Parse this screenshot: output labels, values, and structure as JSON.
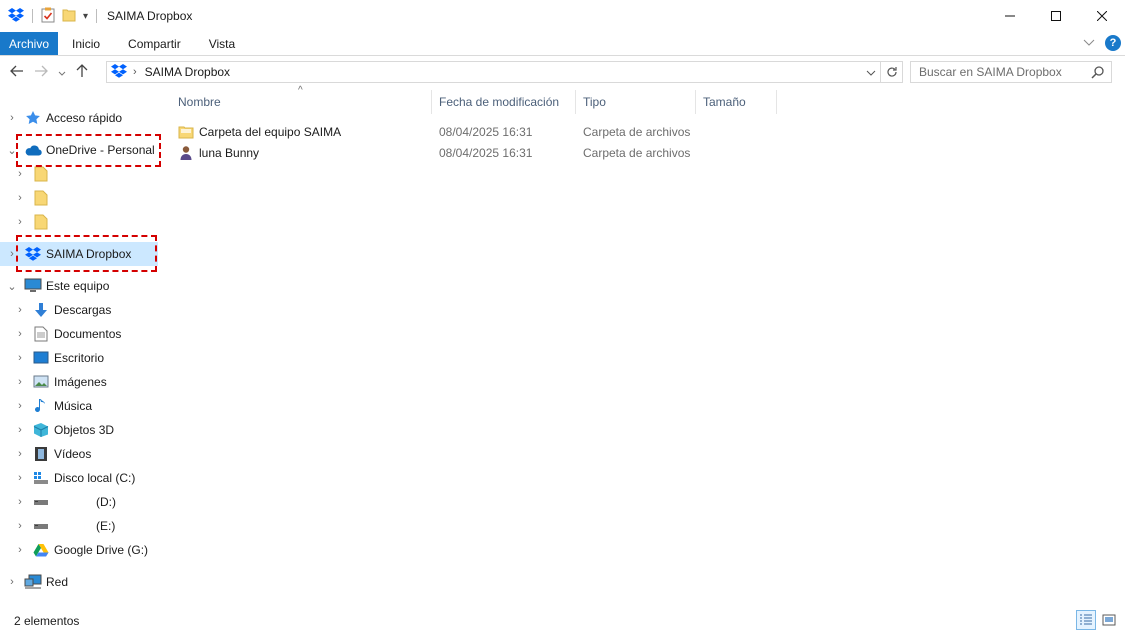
{
  "window": {
    "title": "SAIMA Dropbox"
  },
  "ribbon": {
    "tabs": [
      "Archivo",
      "Inicio",
      "Compartir",
      "Vista"
    ],
    "help": "?"
  },
  "address": {
    "path": "SAIMA Dropbox",
    "search_placeholder": "Buscar en SAIMA Dropbox"
  },
  "nav": {
    "quick": "Acceso rápido",
    "onedrive": "OneDrive - Personal",
    "dropbox": "SAIMA Dropbox",
    "pc": "Este equipo",
    "pc_items": [
      "Descargas",
      "Documentos",
      "Escritorio",
      "Imágenes",
      "Música",
      "Objetos 3D",
      "Vídeos",
      "Disco local (C:)",
      "(D:)",
      "(E:)",
      "Google Drive (G:)"
    ],
    "network": "Red"
  },
  "columns": [
    "Nombre",
    "Fecha de modificación",
    "Tipo",
    "Tamaño"
  ],
  "files": [
    {
      "name": "Carpeta del equipo SAIMA",
      "date": "08/04/2025 16:31",
      "type": "Carpeta de archivos"
    },
    {
      "name": "luna Bunny",
      "date": "08/04/2025 16:31",
      "type": "Carpeta de archivos"
    }
  ],
  "status": {
    "count": "2 elementos"
  },
  "colors": {
    "accent": "#1979ca",
    "selection": "#cce8ff",
    "highlight": "#d40000"
  },
  "icons": [
    "dropbox-icon",
    "folder-icon",
    "onedrive-cloud-icon",
    "star-icon",
    "pc-icon",
    "download-icon",
    "network-icon"
  ]
}
